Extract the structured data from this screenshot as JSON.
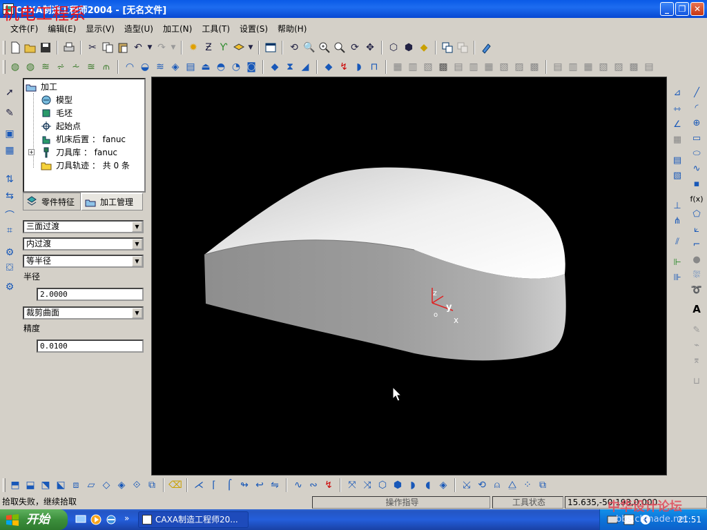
{
  "window": {
    "title": "CAXA制造工程师2004 - [无名文件]",
    "watermark": "机电工程系",
    "controls": {
      "minimize": "_",
      "restore": "❐",
      "close": "✕"
    }
  },
  "menu": [
    "文件(F)",
    "编辑(E)",
    "显示(V)",
    "造型(U)",
    "加工(N)",
    "工具(T)",
    "设置(S)",
    "帮助(H)"
  ],
  "tree": {
    "root": "加工",
    "items": [
      "模型",
      "毛坯",
      "起始点",
      "机床后置 ： fanuc",
      "刀具库 ： fanuc",
      "刀具轨迹 ： 共 0 条"
    ]
  },
  "tabs": {
    "feature": "零件特征",
    "machining": "加工管理"
  },
  "params": {
    "combo1": "三面过渡",
    "combo2": "内过渡",
    "combo3": "等半径",
    "radius_label": "半径",
    "radius_value": "2.0000",
    "combo4": "裁剪曲面",
    "precision_label": "精度",
    "precision_value": "0.0100"
  },
  "axes": {
    "z": "z",
    "y": "y",
    "x": "x",
    "o": "o"
  },
  "right_tool_labels": {
    "fx": "f(x)",
    "text": "A"
  },
  "status": {
    "message": "拾取失败，继续拾取",
    "guide": "操作指导",
    "tool_state": "工具状态",
    "coords": "15.635,-50.193,0.000"
  },
  "taskbar": {
    "start": "开始",
    "task": "CAXA制造工程师20...",
    "clock": "21:51"
  },
  "overlay": {
    "forum": "中华设计论坛",
    "site": "bbs.chinade.net"
  }
}
